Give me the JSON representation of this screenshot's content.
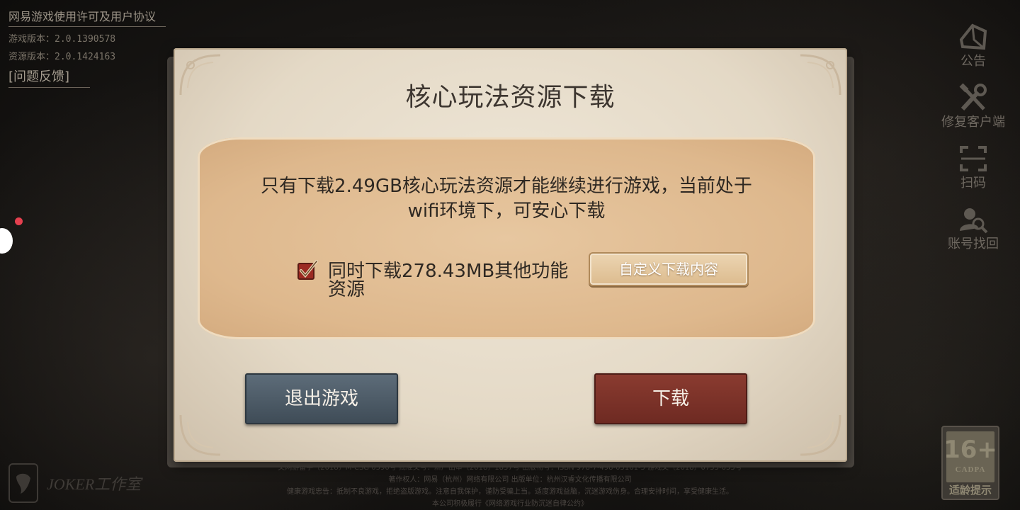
{
  "top_left": {
    "agreement_link": "网易游戏使用许可及用户协议",
    "game_version": "游戏版本：2.0.1390578",
    "resource_version": "资源版本：2.0.1424163",
    "feedback": "[问题反馈]"
  },
  "side_menu": [
    {
      "label": "公告",
      "icon": "announcement-icon"
    },
    {
      "label": "修复客户端",
      "icon": "repair-tools-icon"
    },
    {
      "label": "扫码",
      "icon": "scan-code-icon"
    },
    {
      "label": "账号找回",
      "icon": "account-recovery-icon"
    }
  ],
  "dialog": {
    "title": "核心玩法资源下载",
    "message_line1": "只有下载2.49GB核心玩法资源才能继续进行游戏，当前处于",
    "message_line2": "wifi环境下，可安心下载",
    "checkbox_checked": true,
    "checkbox_label": "同时下载278.43MB其他功能资源",
    "custom_button": "自定义下载内容",
    "exit_button": "退出游戏",
    "download_button": "下载"
  },
  "studio": {
    "name": "JOKER工作室"
  },
  "legal": {
    "line1": "文网游备字〔2018〕M-CSG 0590号  批准文号：新广出审〔2018〕1837号  出版物号：ISBN 978-7-498-05161-5  游戏文〔2018〕0755-055号",
    "line2": "著作权人：网易（杭州）网络有限公司  出版单位：杭州汉睿文化传播有限公司",
    "line3": "健康游戏忠告：抵制不良游戏，拒绝盗版游戏。注意自我保护，谨防受骗上当。适度游戏益脑，沉迷游戏伤身。合理安排时间，享受健康生活。",
    "line4": "本公司积极履行《网络游戏行业防沉迷自律公约》"
  },
  "age_badge": {
    "rating": "16+",
    "org": "CADPA",
    "tip": "适龄提示"
  },
  "colors": {
    "exit_button": "#4f5d69",
    "download_button": "#7d3228",
    "panel": "#deb88d",
    "checkbox": "#9b2a22"
  }
}
